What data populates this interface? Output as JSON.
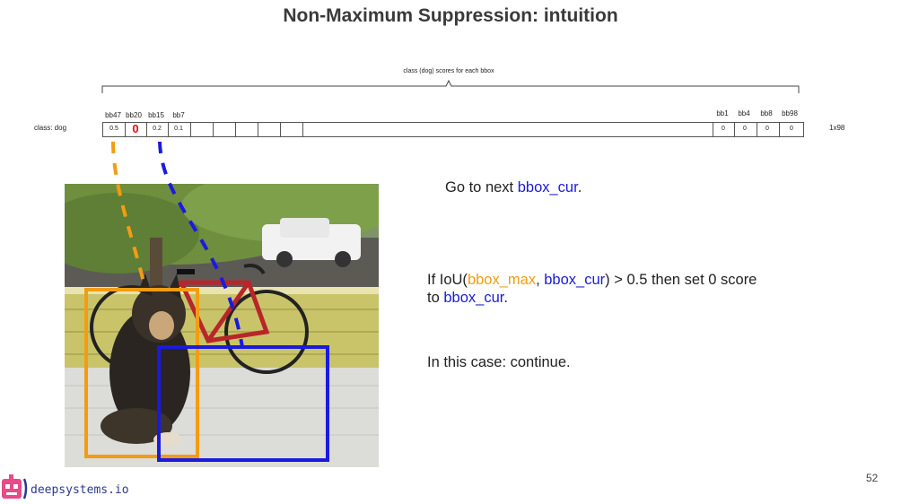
{
  "slide": {
    "title": "Non-Maximum Suppression: intuition",
    "page_number": "52",
    "brand": "deepsystems.io"
  },
  "scores": {
    "brace_label": "class (dog) scores for each bbox",
    "row_label": "class: dog",
    "dimension": "1x98",
    "left_headers": [
      "bb47",
      "bb20",
      "bb15",
      "bb7"
    ],
    "left_values": [
      "0.5",
      "0",
      "0.2",
      "0.1"
    ],
    "right_headers": [
      "bb1",
      "bb4",
      "bb8",
      "bb98"
    ],
    "right_values": [
      "0",
      "0",
      "0",
      "0"
    ]
  },
  "text": {
    "next_prefix": "Go to next ",
    "next_var": "bbox_cur",
    "next_suffix": ".",
    "if_prefix": "If IoU(",
    "if_max": "bbox_max",
    "if_comma": ", ",
    "if_cur": "bbox_cur",
    "if_mid": ") > 0.5 then set 0 score",
    "if_to": "to ",
    "if_cur2": "bbox_cur",
    "if_end": ".",
    "case_line": "In this case: continue."
  },
  "colors": {
    "bbox_max": "#f39c12",
    "bbox_cur": "#1a1adf",
    "zeroed_score": "#e01010"
  }
}
